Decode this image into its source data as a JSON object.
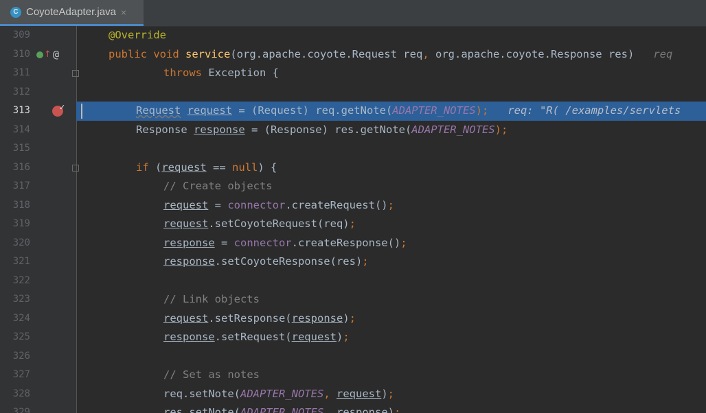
{
  "tab": {
    "icon_letter": "C",
    "filename": "CoyoteAdapter.java",
    "close": "×"
  },
  "gutter": {
    "numbers": [
      "309",
      "310",
      "311",
      "312",
      "313",
      "314",
      "315",
      "316",
      "317",
      "318",
      "319",
      "320",
      "321",
      "322",
      "323",
      "324",
      "325",
      "326",
      "327",
      "328",
      "329"
    ]
  },
  "code": {
    "l309": {
      "a": "@Override"
    },
    "l310": {
      "a": "public",
      "b": " ",
      "c": "void",
      "d": " ",
      "e": "service",
      "f": "(org.apache.coyote.Request req",
      "g": ",",
      "h": " org.apache.coyote.Response res)",
      "i": "   req"
    },
    "l311": {
      "a": "throws",
      "b": " Exception {"
    },
    "l313": {
      "a": "Request",
      "b": " ",
      "c": "request",
      "d": " = (Request) req.getNote(",
      "e": "ADAPTER_NOTES",
      "f": ");",
      "g": "   req: \"R( /examples/servlets"
    },
    "l314": {
      "a": "Response ",
      "b": "response",
      "c": " = (Response) res.getNote(",
      "d": "ADAPTER_NOTES",
      "e": ");"
    },
    "l316": {
      "a": "if",
      "b": " (",
      "c": "request",
      "d": " == ",
      "e": "null",
      "f": ") {"
    },
    "l317": {
      "a": "// Create objects"
    },
    "l318": {
      "a": "request",
      "b": " = ",
      "c": "connector",
      "d": ".createRequest()",
      "e": ";"
    },
    "l319": {
      "a": "request",
      "b": ".setCoyoteRequest(req)",
      "c": ";"
    },
    "l320": {
      "a": "response",
      "b": " = ",
      "c": "connector",
      "d": ".createResponse()",
      "e": ";"
    },
    "l321": {
      "a": "response",
      "b": ".setCoyoteResponse(res)",
      "c": ";"
    },
    "l323": {
      "a": "// Link objects"
    },
    "l324": {
      "a": "request",
      "b": ".setResponse(",
      "c": "response",
      "d": ")",
      "e": ";"
    },
    "l325": {
      "a": "response",
      "b": ".setRequest(",
      "c": "request",
      "d": ")",
      "e": ";"
    },
    "l327": {
      "a": "// Set as notes"
    },
    "l328": {
      "a": "req.setNote(",
      "b": "ADAPTER_NOTES",
      "c": ",",
      "d": " ",
      "e": "request",
      "f": ")",
      "g": ";"
    },
    "l329": {
      "a": "res.setNote(",
      "b": "ADAPTER_NOTES",
      "c": ",",
      "d": " ",
      "e": "response",
      "f": ")",
      "g": ";"
    }
  },
  "icons": {
    "implementation": "implementation-icon",
    "override_up": "override-arrow-icon",
    "annotation": "@",
    "breakpoint": "breakpoint-icon"
  },
  "colors": {
    "highlight": "#2d6099",
    "background": "#2b2b2b",
    "keyword": "#cc7832",
    "accent": "#4a88c7"
  }
}
